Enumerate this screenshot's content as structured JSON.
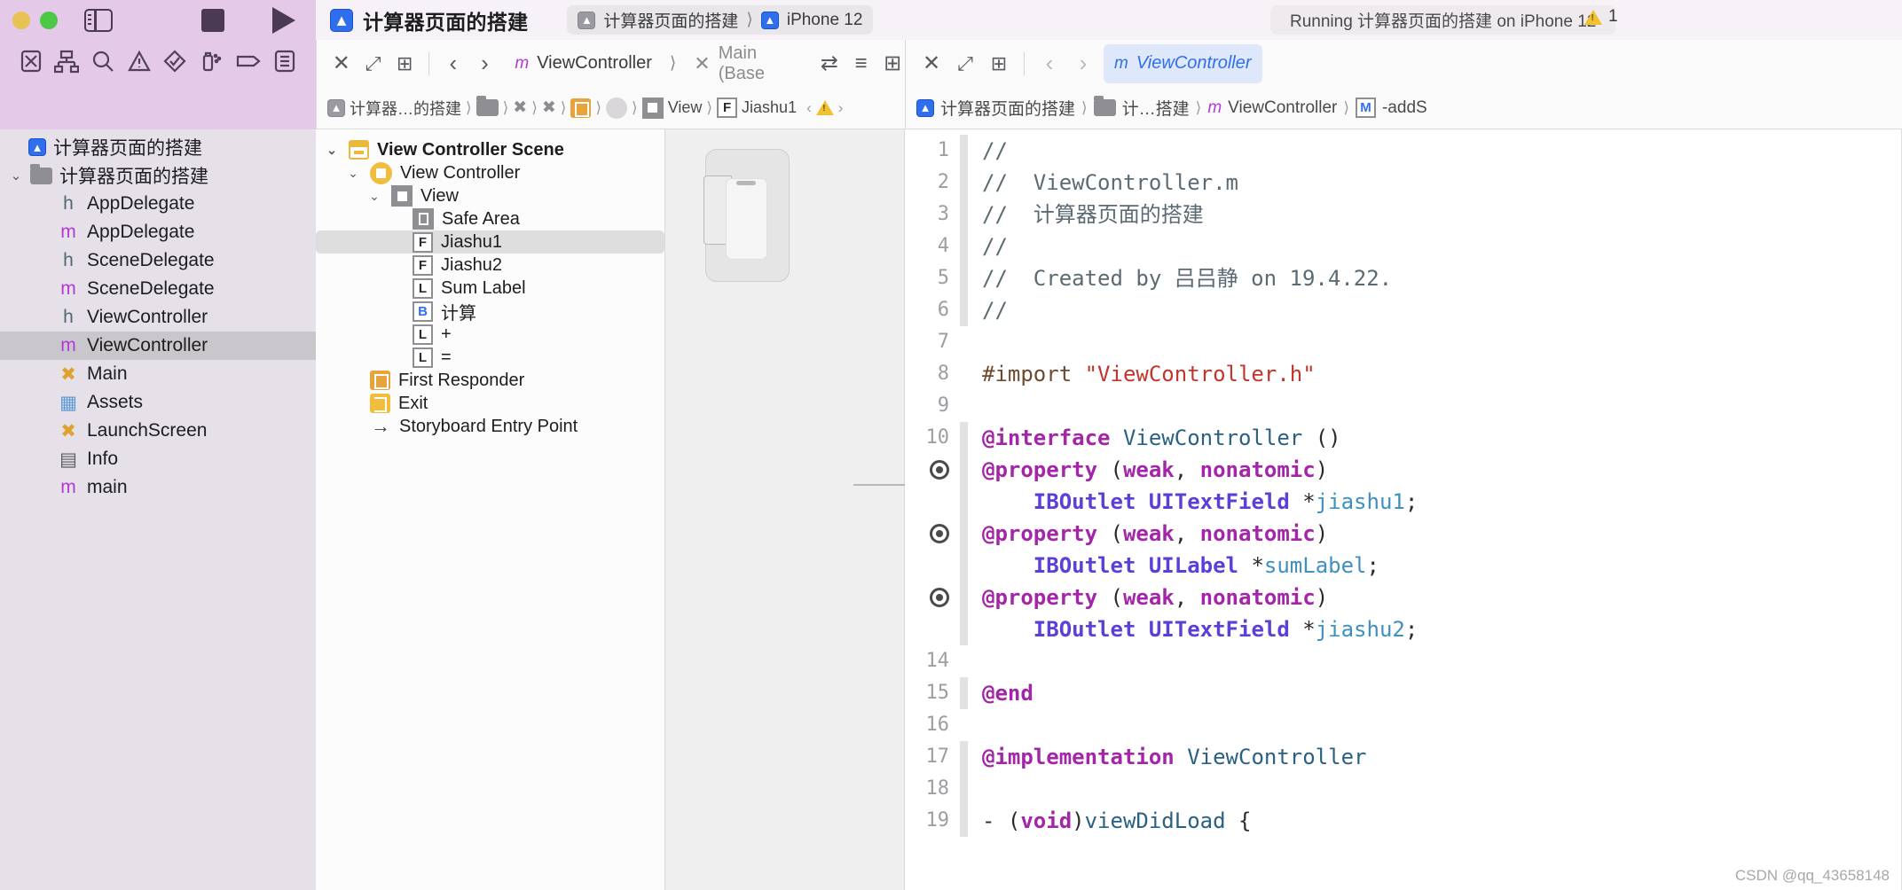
{
  "toolbar": {
    "app_title": "计算器页面的搭建",
    "scheme_project": "计算器页面的搭建",
    "scheme_device": "iPhone 12",
    "status": "Running 计算器页面的搭建 on iPhone 12",
    "warning_count": "1",
    "app_icon": "appstore-icon",
    "sidebar_toggle": "sidebar-toggle-icon",
    "stop_label": "stop-button",
    "run_label": "run-button"
  },
  "navigator_toolbar": {
    "icons": [
      "folder-navigator-icon",
      "source-control-icon",
      "search-icon",
      "issue-navigator-icon",
      "test-navigator-icon",
      "debug-navigator-icon",
      "breakpoint-navigator-icon",
      "report-navigator-icon"
    ]
  },
  "editor_tabs": {
    "center": {
      "close": "✕",
      "expand": "⤢",
      "grid": "⊞",
      "back": "‹",
      "forward": "›",
      "file_badge": "m",
      "file_name": "ViewController",
      "secondary_badge": "✕",
      "secondary_name": "Main (Base",
      "assistant_icon": "⇄",
      "align_icon": "≡",
      "layout_icon": "⊞"
    },
    "right": {
      "close": "✕",
      "expand": "⤢",
      "grid": "⊞",
      "back": "‹",
      "forward": "›",
      "file_badge": "m",
      "file_name": "ViewController"
    }
  },
  "path_bar_center": {
    "project": "计算器…的搭建",
    "folder": "folder-icon",
    "main_storyboard": "Main.storyboard",
    "scene_icon": "scene-icon",
    "view_controller_icon": "view-controller-icon",
    "view_label": "View",
    "field_badge": "F",
    "field_name": "Jiashu1",
    "prev": "‹",
    "next": "›",
    "warning": "warning-icon"
  },
  "path_bar_right": {
    "project": "计算器页面的搭建",
    "folder_short": "计…搭建",
    "file_badge": "m",
    "file_name": "ViewController",
    "symbol_badge": "M",
    "symbol_name": "-addS"
  },
  "navigator": {
    "items": [
      {
        "label": "计算器页面的搭建",
        "icon": "appstore-icon",
        "kind": "project",
        "indent": 0,
        "selected": false,
        "twisty": ""
      },
      {
        "label": "计算器页面的搭建",
        "icon": "folder-icon",
        "kind": "group",
        "indent": 1,
        "selected": false,
        "twisty": "⌄"
      },
      {
        "label": "AppDelegate",
        "icon": "h",
        "kind": "header",
        "indent": 2,
        "selected": false,
        "twisty": ""
      },
      {
        "label": "AppDelegate",
        "icon": "m",
        "kind": "impl",
        "indent": 2,
        "selected": false,
        "twisty": ""
      },
      {
        "label": "SceneDelegate",
        "icon": "h",
        "kind": "header",
        "indent": 2,
        "selected": false,
        "twisty": ""
      },
      {
        "label": "SceneDelegate",
        "icon": "m",
        "kind": "impl",
        "indent": 2,
        "selected": false,
        "twisty": ""
      },
      {
        "label": "ViewController",
        "icon": "h",
        "kind": "header",
        "indent": 2,
        "selected": false,
        "twisty": ""
      },
      {
        "label": "ViewController",
        "icon": "m",
        "kind": "impl",
        "indent": 2,
        "selected": true,
        "twisty": ""
      },
      {
        "label": "Main",
        "icon": "storyboard",
        "kind": "storyboard",
        "indent": 2,
        "selected": false,
        "twisty": ""
      },
      {
        "label": "Assets",
        "icon": "assets",
        "kind": "assets",
        "indent": 2,
        "selected": false,
        "twisty": ""
      },
      {
        "label": "LaunchScreen",
        "icon": "storyboard",
        "kind": "storyboard",
        "indent": 2,
        "selected": false,
        "twisty": ""
      },
      {
        "label": "Info",
        "icon": "plist",
        "kind": "plist",
        "indent": 2,
        "selected": false,
        "twisty": ""
      },
      {
        "label": "main",
        "icon": "m",
        "kind": "impl",
        "indent": 2,
        "selected": false,
        "twisty": ""
      }
    ]
  },
  "outline": {
    "items": [
      {
        "label": "View Controller Scene",
        "icon": "scene-icon",
        "indent": 0,
        "twisty": "⌄",
        "selected": false,
        "bold": true
      },
      {
        "label": "View Controller",
        "icon": "view-controller-icon",
        "indent": 1,
        "twisty": "⌄",
        "selected": false,
        "bold": false
      },
      {
        "label": "View",
        "icon": "view-icon",
        "indent": 2,
        "twisty": "⌄",
        "selected": false,
        "bold": false
      },
      {
        "label": "Safe Area",
        "icon": "safe-area-icon",
        "indent": 3,
        "twisty": "",
        "selected": false,
        "bold": false
      },
      {
        "label": "Jiashu1",
        "icon": "F",
        "indent": 3,
        "twisty": "",
        "selected": true,
        "bold": false
      },
      {
        "label": "Jiashu2",
        "icon": "F",
        "indent": 3,
        "twisty": "",
        "selected": false,
        "bold": false
      },
      {
        "label": "Sum Label",
        "icon": "L",
        "indent": 3,
        "twisty": "",
        "selected": false,
        "bold": false
      },
      {
        "label": "计算",
        "icon": "B",
        "indent": 3,
        "twisty": "",
        "selected": false,
        "bold": false
      },
      {
        "label": "+",
        "icon": "L",
        "indent": 3,
        "twisty": "",
        "selected": false,
        "bold": false
      },
      {
        "label": "=",
        "icon": "L",
        "indent": 3,
        "twisty": "",
        "selected": false,
        "bold": false
      },
      {
        "label": "First Responder",
        "icon": "first-responder-icon",
        "indent": 1,
        "twisty": "",
        "selected": false,
        "bold": false
      },
      {
        "label": "Exit",
        "icon": "exit-icon",
        "indent": 1,
        "twisty": "",
        "selected": false,
        "bold": false
      },
      {
        "label": "Storyboard Entry Point",
        "icon": "entry-point-icon",
        "indent": 1,
        "twisty": "",
        "selected": false,
        "bold": false
      }
    ]
  },
  "canvas": {
    "device_name": "iPhone 12 preview"
  },
  "code": {
    "lines": [
      {
        "num": "1",
        "breakpoint": false,
        "modified": true,
        "tokens": [
          {
            "t": "//",
            "c": "c-cmt"
          }
        ]
      },
      {
        "num": "2",
        "breakpoint": false,
        "modified": true,
        "tokens": [
          {
            "t": "//  ViewController.m",
            "c": "c-cmt"
          }
        ]
      },
      {
        "num": "3",
        "breakpoint": false,
        "modified": true,
        "tokens": [
          {
            "t": "//  计算器页面的搭建",
            "c": "c-cmt"
          }
        ]
      },
      {
        "num": "4",
        "breakpoint": false,
        "modified": true,
        "tokens": [
          {
            "t": "//",
            "c": "c-cmt"
          }
        ]
      },
      {
        "num": "5",
        "breakpoint": false,
        "modified": true,
        "tokens": [
          {
            "t": "//  Created by 吕吕静 on 19.4.22.",
            "c": "c-cmt"
          }
        ]
      },
      {
        "num": "6",
        "breakpoint": false,
        "modified": true,
        "tokens": [
          {
            "t": "//",
            "c": "c-cmt"
          }
        ]
      },
      {
        "num": "7",
        "breakpoint": false,
        "modified": false,
        "tokens": []
      },
      {
        "num": "8",
        "breakpoint": false,
        "modified": false,
        "tokens": [
          {
            "t": "#import ",
            "c": "c-pre"
          },
          {
            "t": "\"ViewController.h\"",
            "c": "c-str"
          }
        ]
      },
      {
        "num": "9",
        "breakpoint": false,
        "modified": false,
        "tokens": []
      },
      {
        "num": "10",
        "breakpoint": false,
        "modified": true,
        "tokens": [
          {
            "t": "@interface",
            "c": "c-kw"
          },
          {
            "t": " ",
            "c": "c-pln"
          },
          {
            "t": "ViewController",
            "c": "c-type"
          },
          {
            "t": " ()",
            "c": "c-pln"
          }
        ]
      },
      {
        "num": "",
        "breakpoint": true,
        "modified": true,
        "tokens": [
          {
            "t": "@property",
            "c": "c-kw"
          },
          {
            "t": " (",
            "c": "c-pln"
          },
          {
            "t": "weak",
            "c": "c-kw"
          },
          {
            "t": ", ",
            "c": "c-pln"
          },
          {
            "t": "nonatomic",
            "c": "c-kw"
          },
          {
            "t": ")",
            "c": "c-pln"
          }
        ]
      },
      {
        "num": "",
        "breakpoint": false,
        "modified": true,
        "tokens": [
          {
            "t": "    ",
            "c": "c-pln"
          },
          {
            "t": "IBOutlet",
            "c": "c-ib"
          },
          {
            "t": " ",
            "c": "c-pln"
          },
          {
            "t": "UITextField",
            "c": "c-ib"
          },
          {
            "t": " *",
            "c": "c-pln"
          },
          {
            "t": "jiashu1",
            "c": "c-var"
          },
          {
            "t": ";",
            "c": "c-pln"
          }
        ]
      },
      {
        "num": "",
        "breakpoint": true,
        "modified": true,
        "tokens": [
          {
            "t": "@property",
            "c": "c-kw"
          },
          {
            "t": " (",
            "c": "c-pln"
          },
          {
            "t": "weak",
            "c": "c-kw"
          },
          {
            "t": ", ",
            "c": "c-pln"
          },
          {
            "t": "nonatomic",
            "c": "c-kw"
          },
          {
            "t": ")",
            "c": "c-pln"
          }
        ]
      },
      {
        "num": "",
        "breakpoint": false,
        "modified": true,
        "tokens": [
          {
            "t": "    ",
            "c": "c-pln"
          },
          {
            "t": "IBOutlet",
            "c": "c-ib"
          },
          {
            "t": " ",
            "c": "c-pln"
          },
          {
            "t": "UILabel",
            "c": "c-ib"
          },
          {
            "t": " *",
            "c": "c-pln"
          },
          {
            "t": "sumLabel",
            "c": "c-var"
          },
          {
            "t": ";",
            "c": "c-pln"
          }
        ]
      },
      {
        "num": "",
        "breakpoint": true,
        "modified": true,
        "tokens": [
          {
            "t": "@property",
            "c": "c-kw"
          },
          {
            "t": " (",
            "c": "c-pln"
          },
          {
            "t": "weak",
            "c": "c-kw"
          },
          {
            "t": ", ",
            "c": "c-pln"
          },
          {
            "t": "nonatomic",
            "c": "c-kw"
          },
          {
            "t": ")",
            "c": "c-pln"
          }
        ]
      },
      {
        "num": "",
        "breakpoint": false,
        "modified": true,
        "tokens": [
          {
            "t": "    ",
            "c": "c-pln"
          },
          {
            "t": "IBOutlet",
            "c": "c-ib"
          },
          {
            "t": " ",
            "c": "c-pln"
          },
          {
            "t": "UITextField",
            "c": "c-ib"
          },
          {
            "t": " *",
            "c": "c-pln"
          },
          {
            "t": "jiashu2",
            "c": "c-var"
          },
          {
            "t": ";",
            "c": "c-pln"
          }
        ]
      },
      {
        "num": "14",
        "breakpoint": false,
        "modified": false,
        "tokens": []
      },
      {
        "num": "15",
        "breakpoint": false,
        "modified": true,
        "tokens": [
          {
            "t": "@end",
            "c": "c-kw"
          }
        ]
      },
      {
        "num": "16",
        "breakpoint": false,
        "modified": false,
        "tokens": []
      },
      {
        "num": "17",
        "breakpoint": false,
        "modified": true,
        "tokens": [
          {
            "t": "@implementation",
            "c": "c-kw"
          },
          {
            "t": " ",
            "c": "c-pln"
          },
          {
            "t": "ViewController",
            "c": "c-type"
          }
        ]
      },
      {
        "num": "18",
        "breakpoint": false,
        "modified": true,
        "tokens": []
      },
      {
        "num": "19",
        "breakpoint": false,
        "modified": true,
        "tokens": [
          {
            "t": "- (",
            "c": "c-pln"
          },
          {
            "t": "void",
            "c": "c-kw"
          },
          {
            "t": ")",
            "c": "c-pln"
          },
          {
            "t": "viewDidLoad",
            "c": "c-type"
          },
          {
            "t": " {",
            "c": "c-pln"
          }
        ]
      }
    ]
  },
  "watermark": "CSDN @qq_43658148"
}
